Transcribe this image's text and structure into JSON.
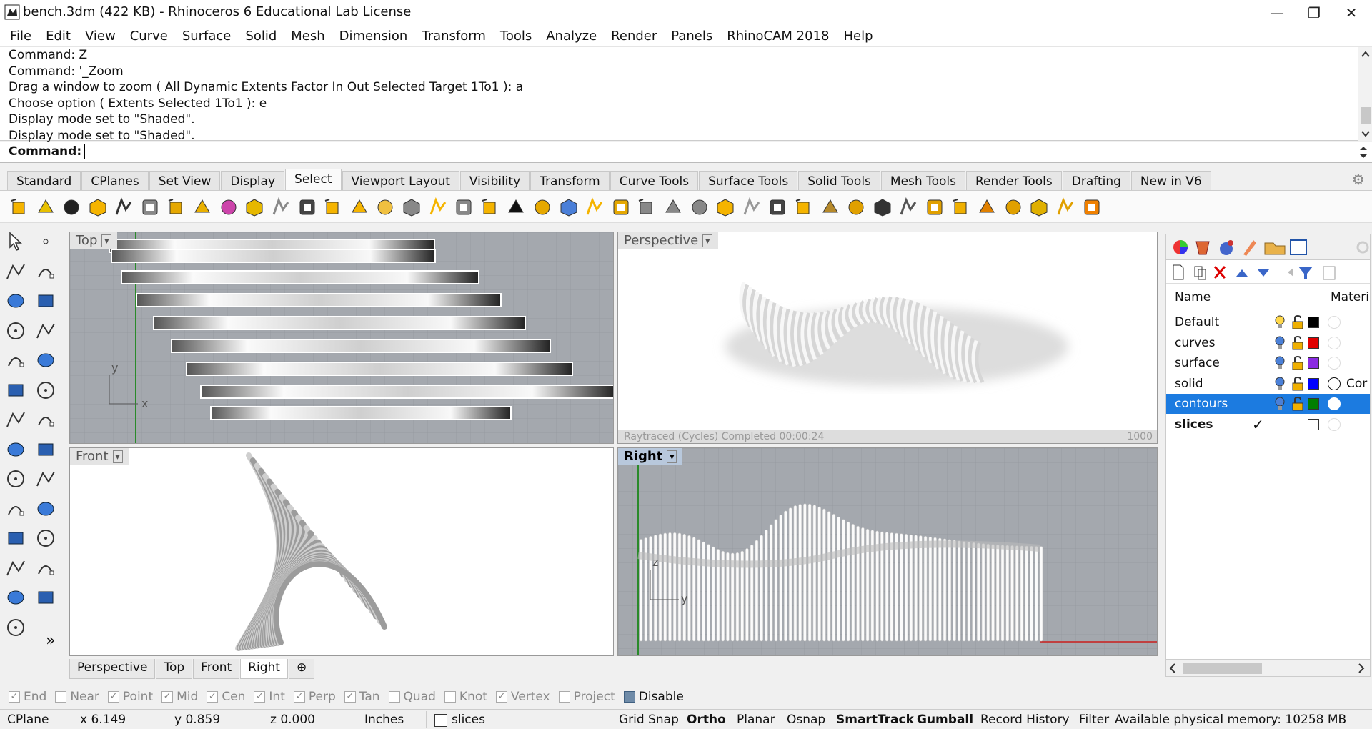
{
  "window": {
    "title": "bench.3dm (422 KB) - Rhinoceros 6 Educational Lab License",
    "minimize_icon": "—",
    "restore_icon": "❐",
    "close_icon": "✕"
  },
  "menu": [
    "File",
    "Edit",
    "View",
    "Curve",
    "Surface",
    "Solid",
    "Mesh",
    "Dimension",
    "Transform",
    "Tools",
    "Analyze",
    "Render",
    "Panels",
    "RhinoCAM 2018",
    "Help"
  ],
  "history": [
    "Command: Z",
    "Command: '_Zoom",
    "Drag a window to zoom ( All  Dynamic  Extents  Factor  In  Out  Selected  Target  1To1 ): a",
    "Choose option ( Extents  Selected  1To1 ): e",
    "Display mode set to \"Shaded\".",
    "Display mode set to \"Shaded\"."
  ],
  "command_prompt": "Command:",
  "toolbar_tabs": [
    "Standard",
    "CPlanes",
    "Set View",
    "Display",
    "Select",
    "Viewport Layout",
    "Visibility",
    "Transform",
    "Curve Tools",
    "Surface Tools",
    "Solid Tools",
    "Mesh Tools",
    "Render Tools",
    "Drafting",
    "New in V6"
  ],
  "active_tab": "Select",
  "viewports": {
    "top": {
      "label": "Top",
      "axis_x": "x",
      "axis_y": "y"
    },
    "perspective": {
      "label": "Perspective",
      "render_status": "Raytraced (Cycles)   Completed   00:00:24",
      "passes": "1000"
    },
    "front": {
      "label": "Front"
    },
    "right": {
      "label": "Right",
      "axis_z": "z",
      "axis_y": "y"
    }
  },
  "viewport_tabs": [
    "Perspective",
    "Top",
    "Front",
    "Right"
  ],
  "active_viewport_tab": "Right",
  "add_tab_icon": "⊕",
  "sidebar_more": "»",
  "layers": {
    "header_name": "Name",
    "header_material": "Materi",
    "rows": [
      {
        "name": "Default",
        "color": "#000000",
        "selected": false,
        "current": false
      },
      {
        "name": "curves",
        "color": "#e00000",
        "selected": false,
        "current": false
      },
      {
        "name": "surface",
        "color": "#8a2be2",
        "selected": false,
        "current": false
      },
      {
        "name": "solid",
        "color": "#0000ff",
        "selected": false,
        "current": false,
        "material": "Cor"
      },
      {
        "name": "contours",
        "color": "#007f00",
        "selected": true,
        "current": false
      },
      {
        "name": "slices",
        "color": "#ffffff",
        "selected": false,
        "current": true
      }
    ],
    "current_mark": "✓"
  },
  "osnaps": [
    {
      "label": "End",
      "checked": true
    },
    {
      "label": "Near",
      "checked": false
    },
    {
      "label": "Point",
      "checked": true
    },
    {
      "label": "Mid",
      "checked": true
    },
    {
      "label": "Cen",
      "checked": true
    },
    {
      "label": "Int",
      "checked": true
    },
    {
      "label": "Perp",
      "checked": true
    },
    {
      "label": "Tan",
      "checked": true
    },
    {
      "label": "Quad",
      "checked": false
    },
    {
      "label": "Knot",
      "checked": false
    },
    {
      "label": "Vertex",
      "checked": true
    },
    {
      "label": "Project",
      "checked": false
    }
  ],
  "osnap_disable": "Disable",
  "status": {
    "cplane": "CPlane",
    "x": "x 6.149",
    "y": "y 0.859",
    "z": "z 0.000",
    "units": "Inches",
    "layer": "slices",
    "grid_snap": "Grid Snap",
    "ortho": "Ortho",
    "planar": "Planar",
    "osnap": "Osnap",
    "smarttrack": "SmartTrack",
    "gumball": "Gumball",
    "record_history": "Record History",
    "filter": "Filter",
    "memory": "Available physical memory: 10258 MB"
  }
}
